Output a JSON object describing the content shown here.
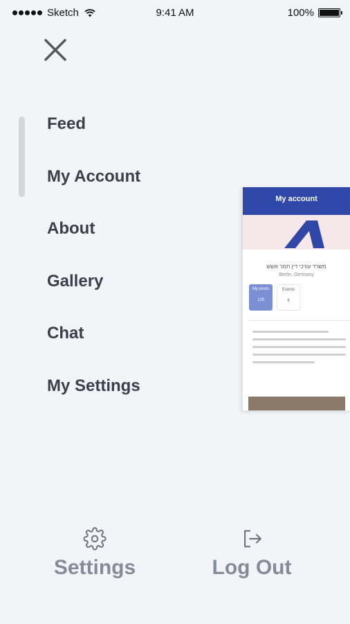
{
  "status_bar": {
    "carrier": "Sketch",
    "time": "9:41 AM",
    "battery": "100%"
  },
  "menu": {
    "items": [
      {
        "label": "Feed"
      },
      {
        "label": "My Account"
      },
      {
        "label": "About"
      },
      {
        "label": "Gallery"
      },
      {
        "label": "Chat"
      },
      {
        "label": "My Settings"
      }
    ]
  },
  "preview": {
    "title": "My account",
    "profile_name": "משרד עורכי דין תמר אשש",
    "location": "Berlin, Germany",
    "stats": [
      {
        "label": "My posts",
        "value": "125"
      },
      {
        "label": "Events",
        "value": "6"
      }
    ]
  },
  "bottom": {
    "settings_label": "Settings",
    "logout_label": "Log Out"
  },
  "colors": {
    "background": "#f3f4f8",
    "menu_text": "#3b3e4b",
    "muted_text": "#878b99",
    "brand_blue": "#2f48a8"
  },
  "icons": [
    "close-icon",
    "gear-icon",
    "logout-icon",
    "wifi-icon",
    "battery-icon"
  ]
}
